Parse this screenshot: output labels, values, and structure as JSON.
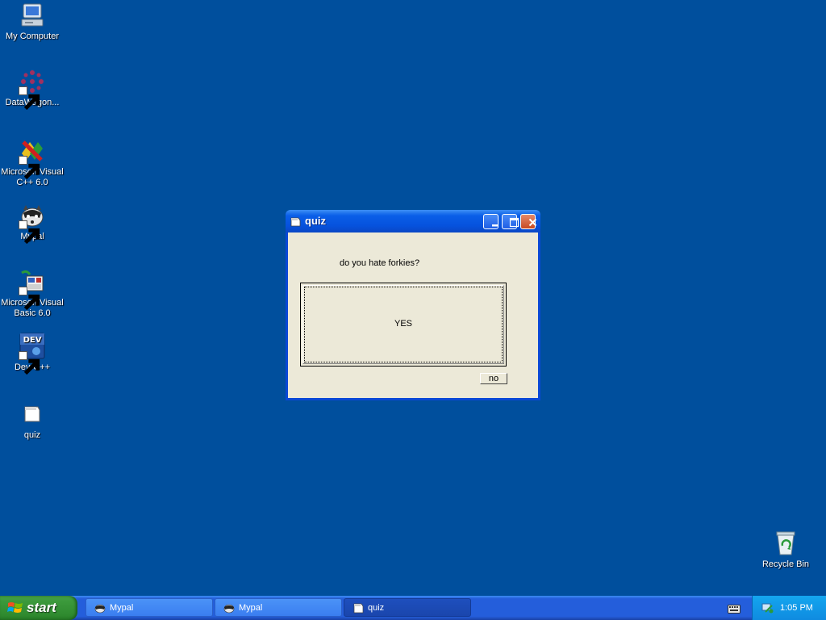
{
  "desktop": {
    "icons": [
      {
        "label": "My Computer",
        "icon": "my-computer-icon"
      },
      {
        "label": "DataWagon...",
        "icon": "datawagon-icon"
      },
      {
        "label": "Microsoft Visual C++ 6.0",
        "icon": "visual-cpp-icon"
      },
      {
        "label": "Mypal",
        "icon": "mypal-icon"
      },
      {
        "label": "Microsoft Visual Basic 6.0",
        "icon": "visual-basic-icon"
      },
      {
        "label": "Dev-C++",
        "icon": "dev-cpp-icon"
      },
      {
        "label": "quiz",
        "icon": "quiz-app-icon"
      },
      {
        "label": "Recycle Bin",
        "icon": "recycle-bin-icon"
      }
    ],
    "background_color": "#004f9d"
  },
  "window": {
    "title": "quiz",
    "question": "do you hate forkies?",
    "yes_label": "YES",
    "no_label": "no"
  },
  "taskbar": {
    "start_label": "start",
    "tasks": [
      {
        "label": "Mypal",
        "active": false
      },
      {
        "label": "Mypal",
        "active": false
      },
      {
        "label": "quiz",
        "active": true
      }
    ],
    "clock": "1:05 PM"
  },
  "colors": {
    "titlebar": "#0a5fe8",
    "start_button": "#3c9a3c",
    "taskbar": "#245edb",
    "tray": "#0f8be0",
    "dialog_face": "#ece9d8"
  }
}
